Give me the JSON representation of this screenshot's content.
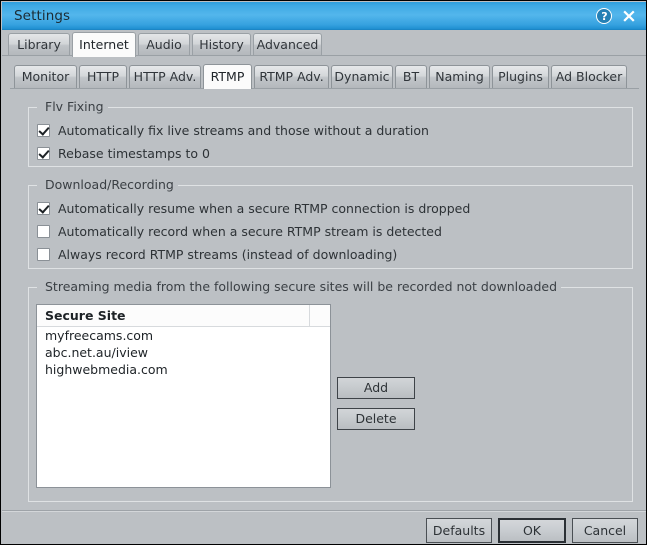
{
  "window": {
    "title": "Settings",
    "help_icon": "help-circle-icon",
    "help_glyph": "?",
    "close_icon": "close-icon",
    "close_glyph": "×",
    "titlebar_color": "#3faae4"
  },
  "outer_tabs": [
    {
      "label": "Library",
      "active": false
    },
    {
      "label": "Internet",
      "active": true
    },
    {
      "label": "Audio",
      "active": false
    },
    {
      "label": "History",
      "active": false
    },
    {
      "label": "Advanced",
      "active": false
    }
  ],
  "inner_tabs": [
    {
      "label": "Monitor",
      "active": false
    },
    {
      "label": "HTTP",
      "active": false
    },
    {
      "label": "HTTP Adv.",
      "active": false
    },
    {
      "label": "RTMP",
      "active": true
    },
    {
      "label": "RTMP Adv.",
      "active": false
    },
    {
      "label": "Dynamic",
      "active": false
    },
    {
      "label": "BT",
      "active": false
    },
    {
      "label": "Naming",
      "active": false
    },
    {
      "label": "Plugins",
      "active": false
    },
    {
      "label": "Ad Blocker",
      "active": false
    }
  ],
  "flv_fixing": {
    "title": "Flv Fixing",
    "options": [
      {
        "label": "Automatically fix live streams and those without a duration",
        "checked": true
      },
      {
        "label": "Rebase timestamps to 0",
        "checked": true
      }
    ]
  },
  "download_recording": {
    "title": "Download/Recording",
    "options": [
      {
        "label": "Automatically resume when a secure RTMP connection is dropped",
        "checked": true
      },
      {
        "label": "Automatically record when a secure RTMP stream is detected",
        "checked": false
      },
      {
        "label": "Always record RTMP streams (instead of downloading)",
        "checked": false
      }
    ]
  },
  "secure_sites": {
    "title": "Streaming media from the following secure sites will be recorded not downloaded",
    "column_header": "Secure Site",
    "rows": [
      "myfreecams.com",
      "abc.net.au/iview",
      "highwebmedia.com"
    ],
    "add_label": "Add",
    "delete_label": "Delete"
  },
  "footer": {
    "defaults_label": "Defaults",
    "ok_label": "OK",
    "cancel_label": "Cancel"
  }
}
